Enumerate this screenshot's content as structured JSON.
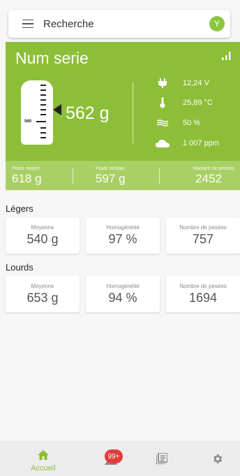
{
  "search": {
    "placeholder": "Recherche",
    "avatar_initial": "Y"
  },
  "device": {
    "name": "Num serie",
    "gauge_label": "560",
    "weight": "562 g",
    "env": [
      {
        "icon": "plug-icon",
        "value": "12,24 V"
      },
      {
        "icon": "thermometer-icon",
        "value": "25,89 °C"
      },
      {
        "icon": "humidity-icon",
        "value": "50 %"
      },
      {
        "icon": "cloud-icon",
        "value": "1 007 ppm"
      }
    ]
  },
  "stats": [
    {
      "label": "Poids moyen",
      "value": "618 g"
    },
    {
      "label": "Poids médian",
      "value": "597 g"
    },
    {
      "label": "Nombre de pesées",
      "value": "2452"
    }
  ],
  "sections": [
    {
      "title": "Légers",
      "tiles": [
        {
          "label": "Moyenne",
          "value": "540 g"
        },
        {
          "label": "Homogénéité",
          "value": "97 %"
        },
        {
          "label": "Nombre de pesées",
          "value": "757"
        }
      ]
    },
    {
      "title": "Lourds",
      "tiles": [
        {
          "label": "Moyenne",
          "value": "653 g"
        },
        {
          "label": "Homogénéité",
          "value": "94 %"
        },
        {
          "label": "Nombre de pesées",
          "value": "1694"
        }
      ]
    }
  ],
  "nav": {
    "home_label": "Accueil",
    "badge": "99+"
  },
  "colors": {
    "accent": "#8cbe37",
    "band": "#a8d064",
    "badge": "#e23b3b"
  }
}
